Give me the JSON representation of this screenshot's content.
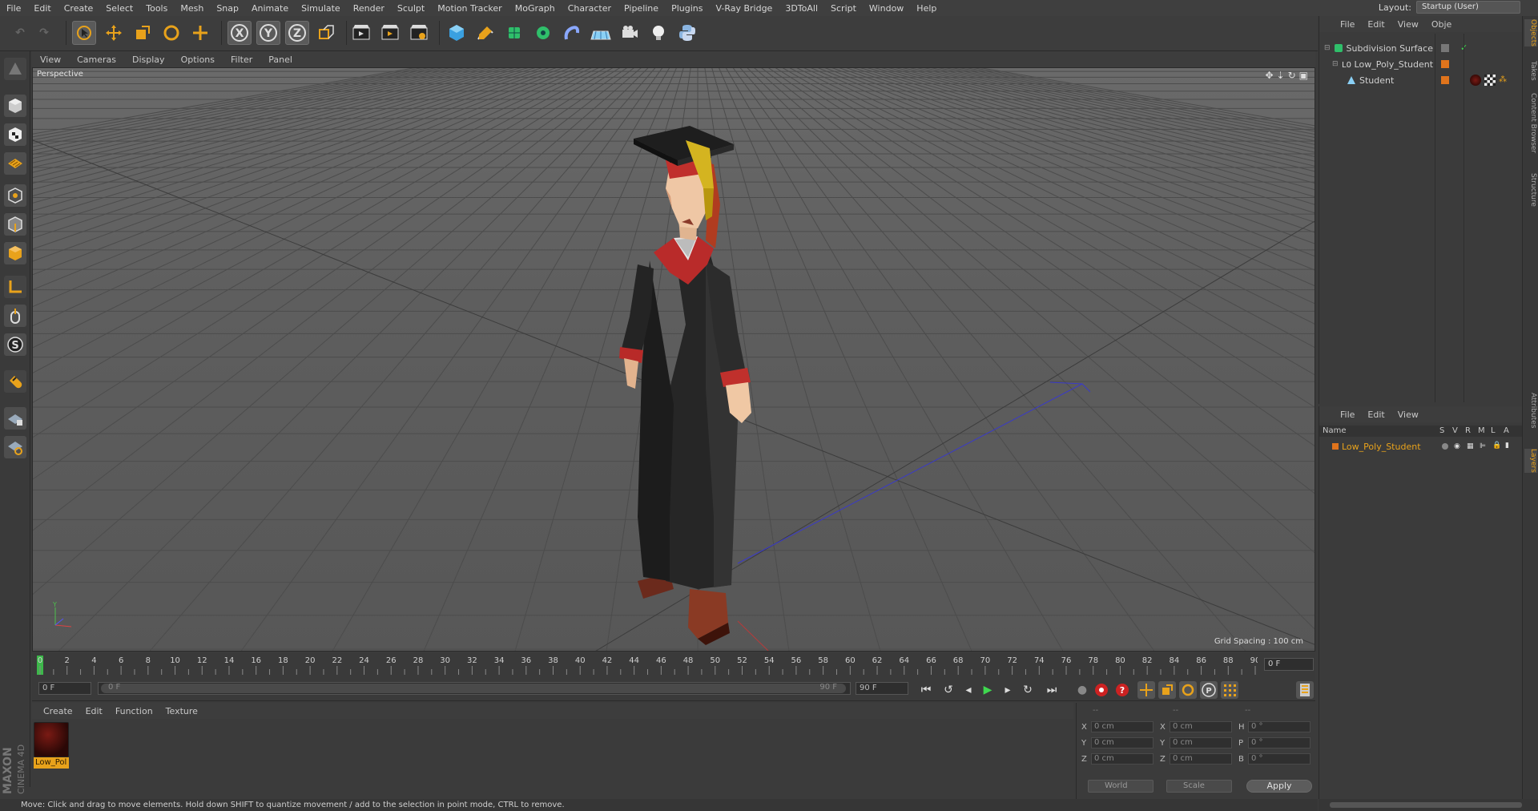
{
  "menu": [
    "File",
    "Edit",
    "Create",
    "Select",
    "Tools",
    "Mesh",
    "Snap",
    "Animate",
    "Simulate",
    "Render",
    "Sculpt",
    "Motion Tracker",
    "MoGraph",
    "Character",
    "Pipeline",
    "Plugins",
    "V-Ray Bridge",
    "3DToAll",
    "Script",
    "Window",
    "Help"
  ],
  "layout": {
    "label": "Layout:",
    "value": "Startup (User)"
  },
  "toolbar": {
    "x_label": "X",
    "y_label": "Y",
    "z_label": "Z"
  },
  "viewport": {
    "menu": [
      "View",
      "Cameras",
      "Display",
      "Options",
      "Filter",
      "Panel"
    ],
    "camera_label": "Perspective",
    "grid_spacing": "Grid Spacing : 100 cm"
  },
  "timeline": {
    "ticks": [
      "0",
      "2",
      "4",
      "6",
      "8",
      "10",
      "12",
      "14",
      "16",
      "18",
      "20",
      "22",
      "24",
      "26",
      "28",
      "30",
      "32",
      "34",
      "36",
      "38",
      "40",
      "42",
      "44",
      "46",
      "48",
      "50",
      "52",
      "54",
      "56",
      "58",
      "60",
      "62",
      "64",
      "66",
      "68",
      "70",
      "72",
      "74",
      "76",
      "78",
      "80",
      "82",
      "84",
      "86",
      "88",
      "90"
    ],
    "current_frame": "0 F"
  },
  "transport": {
    "start": "0 F",
    "range_start": "0 F",
    "range_end": "90 F",
    "end": "90 F"
  },
  "material_manager": {
    "menu": [
      "Create",
      "Edit",
      "Function",
      "Texture"
    ],
    "materials": [
      {
        "label": "Low_Pol"
      }
    ]
  },
  "coordinates": {
    "headers": [
      "--",
      "--",
      "--"
    ],
    "rows": [
      {
        "a": "X",
        "av": "0 cm",
        "b": "X",
        "bv": "0 cm",
        "c": "H",
        "cv": "0 °"
      },
      {
        "a": "Y",
        "av": "0 cm",
        "b": "Y",
        "bv": "0 cm",
        "c": "P",
        "cv": "0 °"
      },
      {
        "a": "Z",
        "av": "0 cm",
        "b": "Z",
        "bv": "0 cm",
        "c": "B",
        "cv": "0 °"
      }
    ],
    "mode": "World",
    "size_mode": "Scale",
    "apply": "Apply"
  },
  "status": "Move: Click and drag to move elements. Hold down SHIFT to quantize movement / add to the selection in point mode, CTRL to remove.",
  "object_manager": {
    "menu": [
      "File",
      "Edit",
      "View",
      "Obje"
    ],
    "objects": [
      {
        "name": "Subdivision Surface"
      },
      {
        "name": "Low_Poly_Student"
      },
      {
        "name": "Student"
      }
    ]
  },
  "layer_manager": {
    "menu": [
      "File",
      "Edit",
      "View"
    ],
    "columns": [
      "Name",
      "S",
      "V",
      "R",
      "M",
      "L",
      "A"
    ],
    "layers": [
      {
        "name": "Low_Poly_Student",
        "color": "#e0741c"
      }
    ]
  },
  "right_tabs": [
    "Objects",
    "Takes",
    "Content Browser",
    "Structure",
    "Attributes",
    "Layers"
  ],
  "logo": {
    "brand": "MAXON",
    "product": "CINEMA 4D"
  },
  "colors": {
    "accent": "#e8a21b",
    "layer_text": "#e8a21b",
    "tag_orange": "#e0741c"
  }
}
